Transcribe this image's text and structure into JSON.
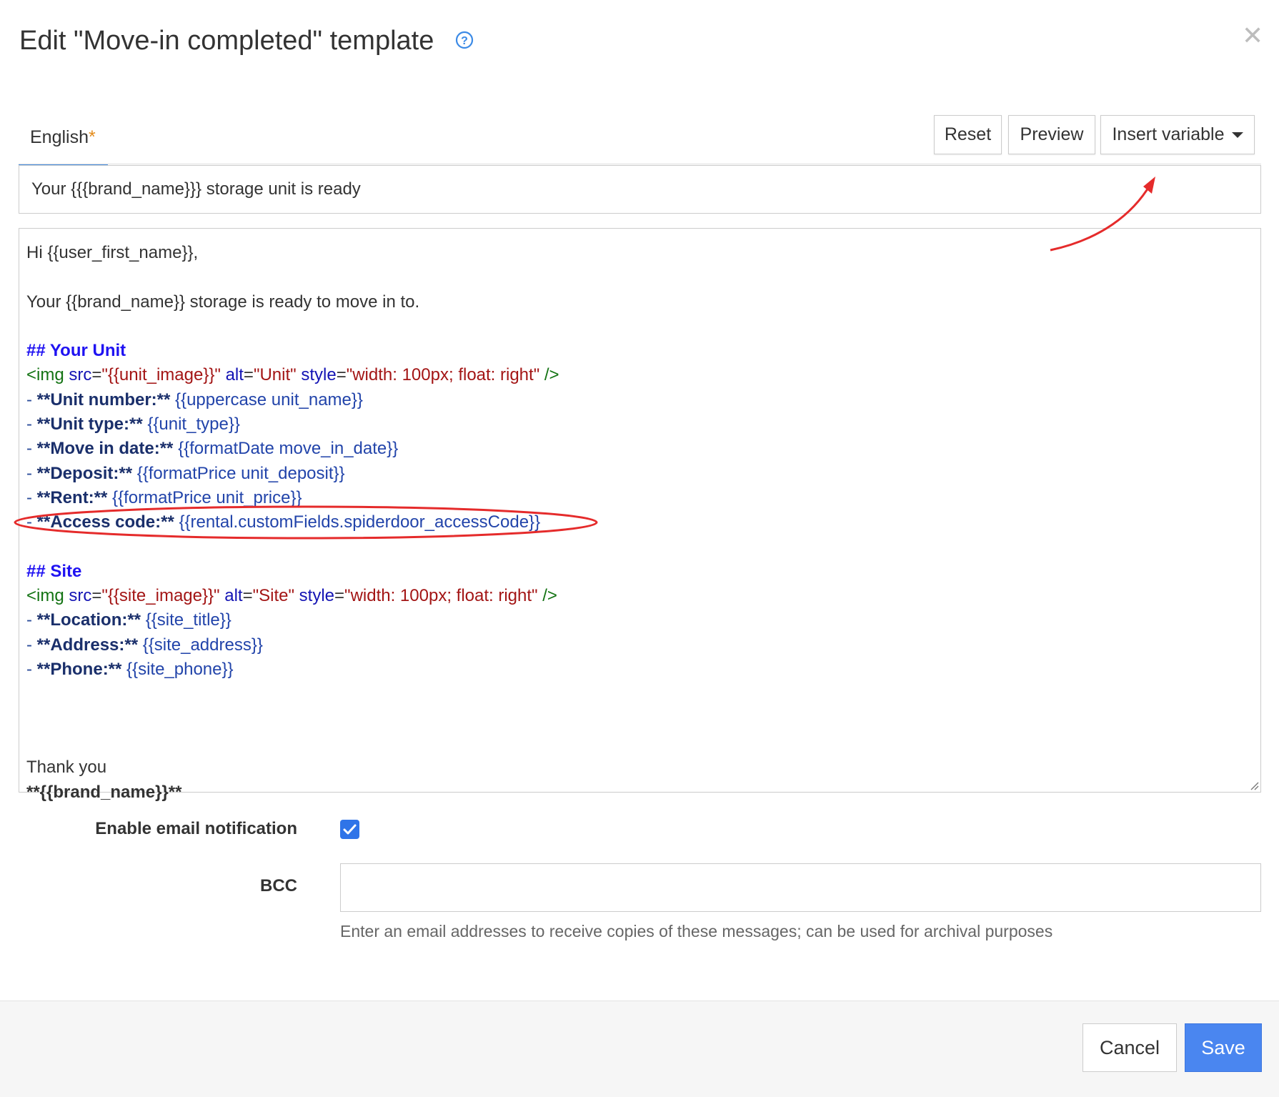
{
  "dialog": {
    "title": "Edit \"Move-in completed\" template",
    "close_glyph": "✕"
  },
  "tabs": [
    {
      "label": "English",
      "modified_marker": "*"
    }
  ],
  "toolbar": {
    "reset_label": "Reset",
    "preview_label": "Preview",
    "insert_variable_label": "Insert variable"
  },
  "subject": {
    "value": "Your {{{brand_name}}} storage unit is ready"
  },
  "body": {
    "greeting": "Hi {{user_first_name}},",
    "intro": "Your {{brand_name}} storage is ready to move in to.",
    "unit_heading": "## Your Unit",
    "unit_img": {
      "open": "<img",
      "src_attr": "src",
      "src_val": "\"{{unit_image}}\"",
      "alt_attr": "alt",
      "alt_val": "\"Unit\"",
      "style_attr": "style",
      "style_val": "\"width: 100px; float: right\"",
      "close": "/>"
    },
    "unit_fields": [
      {
        "label": "**Unit number:**",
        "value": "{{uppercase unit_name}}"
      },
      {
        "label": "**Unit type:**",
        "value": "{{unit_type}}"
      },
      {
        "label": "**Move in date:**",
        "value": "{{formatDate move_in_date}}"
      },
      {
        "label": "**Deposit:**",
        "value": "{{formatPrice unit_deposit}}"
      },
      {
        "label": "**Rent:**",
        "value": "{{formatPrice unit_price}}"
      },
      {
        "label": "**Access code:**",
        "value": "{{rental.customFields.spiderdoor_accessCode}}"
      }
    ],
    "site_heading": "## Site",
    "site_img": {
      "open": "<img",
      "src_attr": "src",
      "src_val": "\"{{site_image}}\"",
      "alt_attr": "alt",
      "alt_val": "\"Site\"",
      "style_attr": "style",
      "style_val": "\"width: 100px; float: right\"",
      "close": "/>"
    },
    "site_fields": [
      {
        "label": "**Location:**",
        "value": "{{site_title}}"
      },
      {
        "label": "**Address:**",
        "value": "{{site_address}}"
      },
      {
        "label": "**Phone:**",
        "value": "{{site_phone}}"
      }
    ],
    "thanks": "Thank you",
    "signature": "**{{brand_name}}**"
  },
  "settings": {
    "email_notification_label": "Enable email notification",
    "email_notification_checked": true,
    "bcc_label": "BCC",
    "bcc_value": "",
    "bcc_help": "Enter an email addresses to receive copies of these messages; can be used for archival purposes"
  },
  "footer": {
    "cancel_label": "Cancel",
    "save_label": "Save"
  },
  "colors": {
    "accent": "#4a86f0",
    "annotation": "#e52b2b"
  }
}
